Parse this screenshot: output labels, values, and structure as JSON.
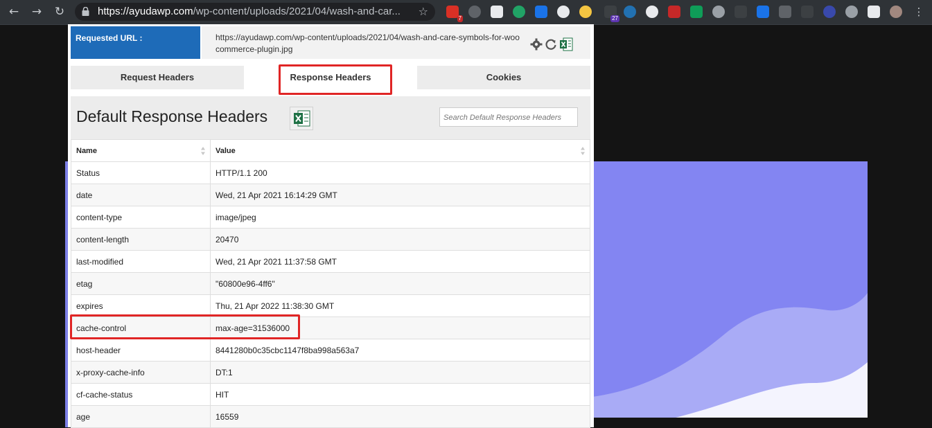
{
  "browser": {
    "url_host": "https://ayudawp.com",
    "url_path": "/wp-content/uploads/2021/04/wash-and-car...",
    "extension_badges": {
      "mail": "7",
      "calendar": "27"
    }
  },
  "popup": {
    "requested_url_label": "Requested URL :",
    "requested_url": "https://ayudawp.com/wp-content/uploads/2021/04/wash-and-care-symbols-for-woocommerce-plugin.jpg",
    "tabs": [
      {
        "label": "Request Headers"
      },
      {
        "label": "Response Headers"
      },
      {
        "label": "Cookies"
      }
    ],
    "section_title": "Default Response Headers",
    "search_placeholder": "Search Default Response Headers",
    "columns": {
      "name": "Name",
      "value": "Value"
    },
    "rows": [
      {
        "name": "Status",
        "value": "HTTP/1.1 200"
      },
      {
        "name": "date",
        "value": "Wed, 21 Apr 2021 16:14:29 GMT"
      },
      {
        "name": "content-type",
        "value": "image/jpeg"
      },
      {
        "name": "content-length",
        "value": "20470"
      },
      {
        "name": "last-modified",
        "value": "Wed, 21 Apr 2021 11:37:58 GMT"
      },
      {
        "name": "etag",
        "value": "\"60800e96-4ff6\""
      },
      {
        "name": "expires",
        "value": "Thu, 21 Apr 2022 11:38:30 GMT"
      },
      {
        "name": "cache-control",
        "value": "max-age=31536000"
      },
      {
        "name": "host-header",
        "value": "8441280b0c35cbc1147f8ba998a563a7"
      },
      {
        "name": "x-proxy-cache-info",
        "value": "DT:1"
      },
      {
        "name": "cf-cache-status",
        "value": "HIT"
      },
      {
        "name": "age",
        "value": "16559"
      }
    ]
  },
  "colors": {
    "accent_blue": "#1e6bb8",
    "highlight_red": "#e02525",
    "background_purple": "#8385f2"
  }
}
